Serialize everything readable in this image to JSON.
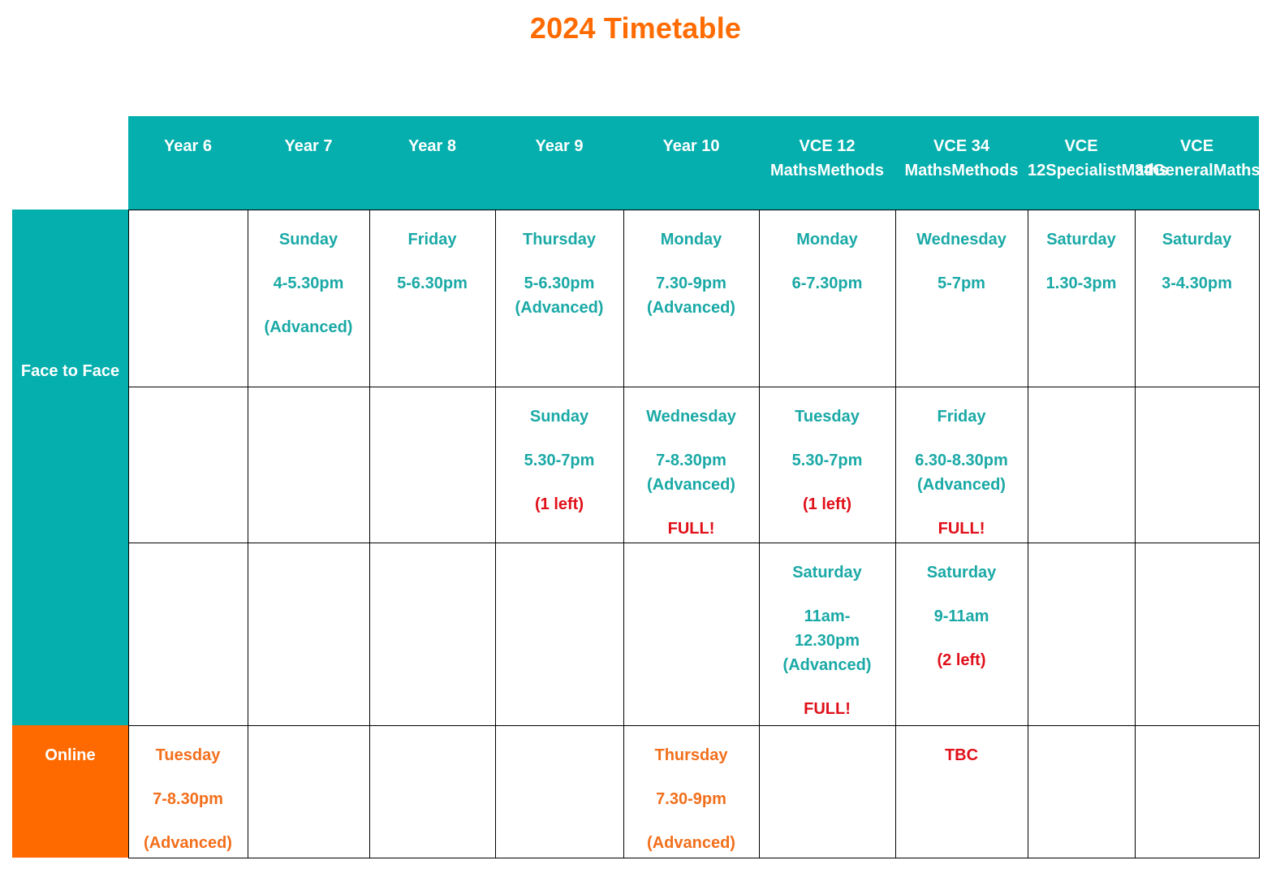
{
  "title": "2024 Timetable",
  "colors": {
    "title": "#ff6b00",
    "header_bg": "#04afad",
    "face_to_face_bg": "#04afad",
    "online_bg": "#ff6a00",
    "face_to_face_text": "#1aa9a6",
    "online_text": "#f26f1c",
    "availability_text": "#e0101a"
  },
  "columns": [
    {
      "label": "Year 6"
    },
    {
      "label": "Year 7"
    },
    {
      "label": "Year 8"
    },
    {
      "label": "Year 9"
    },
    {
      "label": "Year 10"
    },
    {
      "label": "VCE 12 Maths Methods"
    },
    {
      "label": "VCE 34 Maths Methods"
    },
    {
      "label": "VCE 12 Specialist Maths"
    },
    {
      "label": "VCE 34 General Maths"
    }
  ],
  "header_lines": [
    [
      "Year 6"
    ],
    [
      "Year 7"
    ],
    [
      "Year 8"
    ],
    [
      "Year 9"
    ],
    [
      "Year 10"
    ],
    [
      "VCE 12 Maths",
      "Methods"
    ],
    [
      "VCE 34 Maths",
      "Methods"
    ],
    [
      "VCE 12",
      "Specialist",
      "Maths"
    ],
    [
      "VCE 34",
      "General",
      "Maths"
    ]
  ],
  "sections": {
    "face_to_face": {
      "label_lines": [
        "Face to",
        "Face"
      ]
    },
    "online": {
      "label_lines": [
        "Online"
      ]
    }
  },
  "rows": [
    {
      "section": "face_to_face",
      "cells": [
        null,
        {
          "day": "Sunday",
          "time": "4-5.30pm",
          "note": "(Advanced)"
        },
        {
          "day": "Friday",
          "time": "5-6.30pm"
        },
        {
          "day": "Thursday",
          "time": "5-6.30pm",
          "level": "(Advanced)"
        },
        {
          "day": "Monday",
          "time": "7.30-9pm",
          "level": "(Advanced)"
        },
        {
          "day": "Monday",
          "time": "6-7.30pm"
        },
        {
          "day": "Wednesday",
          "time": "5-7pm"
        },
        {
          "day": "Saturday",
          "time": "1.30-3pm"
        },
        {
          "day": "Saturday",
          "time": "3-4.30pm"
        }
      ]
    },
    {
      "section": "face_to_face",
      "cells": [
        null,
        null,
        null,
        {
          "day": "Sunday",
          "time": "5.30-7pm",
          "availability": "(1 left)"
        },
        {
          "day": "Wednesday",
          "time": "7-8.30pm",
          "level": "(Advanced)",
          "availability": "FULL!"
        },
        {
          "day": "Tuesday",
          "time": "5.30-7pm",
          "availability": "(1 left)"
        },
        {
          "day": "Friday",
          "time": "6.30-8.30pm",
          "level": "(Advanced)",
          "availability": "FULL!"
        },
        null,
        null
      ]
    },
    {
      "section": "face_to_face",
      "cells": [
        null,
        null,
        null,
        null,
        null,
        {
          "day": "Saturday",
          "time_lines": [
            "11am-",
            "12.30pm"
          ],
          "level": "(Advanced)",
          "availability": "FULL!"
        },
        {
          "day": "Saturday",
          "time": "9-11am",
          "availability": "(2 left)"
        },
        null,
        null
      ]
    },
    {
      "section": "online",
      "cells": [
        {
          "day": "Tuesday",
          "time": "7-8.30pm",
          "note": "(Advanced)"
        },
        null,
        null,
        null,
        {
          "day": "Thursday",
          "time": "7.30-9pm",
          "note": "(Advanced)"
        },
        null,
        {
          "availability": "TBC"
        },
        null,
        null
      ]
    }
  ]
}
